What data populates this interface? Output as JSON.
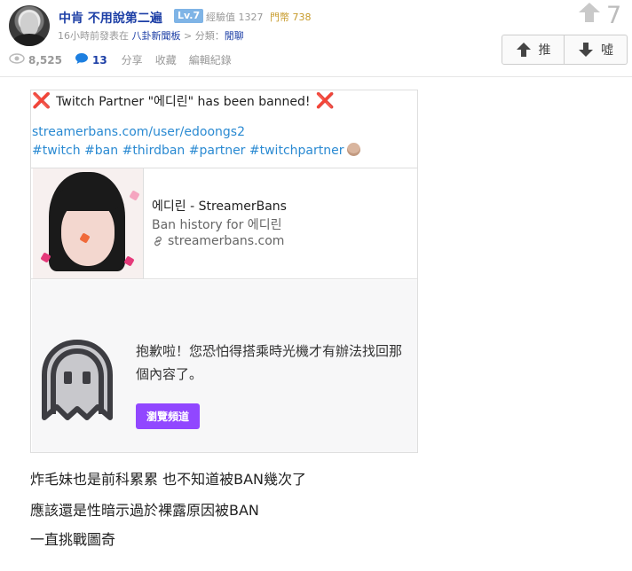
{
  "header": {
    "author": "中肯 不用說第二遍",
    "level": "Lv.7",
    "exp_label": "經驗值 1327",
    "coin_label": "門幣 738",
    "time_text": "16小時前發表在",
    "board": "八卦新聞板",
    "category_sep": ">",
    "category_label": "分類：",
    "category": "閒聊"
  },
  "stats": {
    "views": "8,525",
    "comments": "13",
    "actions": [
      "分享",
      "收藏",
      "編輯紀錄"
    ]
  },
  "vote": {
    "count": "7",
    "up_label": "推",
    "down_label": "噓"
  },
  "embed": {
    "tweet_line": "Twitch Partner \"에디린\" has been banned!",
    "cross_left": "❌",
    "cross_right": "❌",
    "url": "streamerbans.com/user/edoongs2",
    "tags": "#twitch #ban #thirdban #partner #twitchpartner",
    "preview": {
      "title": "에디린 - StreamerBans",
      "description": "Ban history for 에디린",
      "domain": "streamerbans.com"
    },
    "twitch": {
      "message": "抱歉啦！您恐怕得搭乘時光機才有辦法找回那個內容了。",
      "button": "瀏覽頻道"
    }
  },
  "body": {
    "lines": [
      "炸毛妹也是前科累累 也不知道被BAN幾次了",
      "應該還是性暗示過於裸露原因被BAN",
      "一直挑戰圖奇"
    ]
  },
  "colors": {
    "link": "#1d3fa6",
    "tag_blue": "#2a8ad2",
    "twitch_purple": "#9147ff",
    "cross_red": "#d11b2b"
  }
}
